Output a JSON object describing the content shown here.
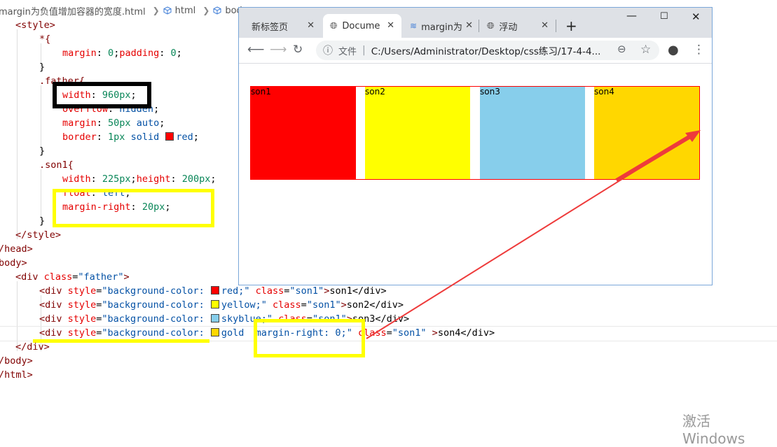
{
  "breadcrumb": {
    "file": "margin为负值增加容器的宽度.html",
    "html": "html",
    "body": "body"
  },
  "code": {
    "l1": "<style>",
    "l2": "*{",
    "l3a": "margin",
    "l3b": ": ",
    "l3c": "0",
    "l3d": ";",
    "l3e": "padding",
    "l3f": ": ",
    "l3g": "0",
    "l3h": ";",
    "l4": "}",
    "l5": ".father{",
    "l6a": "width",
    "l6b": ": ",
    "l6c": "960px",
    "l6d": ";",
    "l7a": "overflow",
    "l7b": ": ",
    "l7c": "hidden",
    "l7d": ";",
    "l8a": "margin",
    "l8b": ": ",
    "l8c": "50px",
    "l8d": " auto",
    "l8e": ";",
    "l9a": "border",
    "l9b": ": ",
    "l9c": "1px",
    "l9d": " solid ",
    "l9e": "red",
    "l9f": ";",
    "l10": "}",
    "l11": ".son1{",
    "l12a": "width",
    "l12b": ": ",
    "l12c": "225px",
    "l12d": ";",
    "l12e": "height",
    "l12f": ": ",
    "l12g": "200px",
    "l12h": ";",
    "l13a": "float",
    "l13b": ": ",
    "l13c": "left",
    "l13d": ";",
    "l14a": "margin-right",
    "l14b": ": ",
    "l14c": "20px",
    "l14d": ";",
    "l15": "}",
    "l16": "</style>",
    "l17": "/head>",
    "l18": "body>",
    "l19a": "<div ",
    "l19b": "class",
    "l19c": "=",
    "l19d": "\"father\"",
    "l19e": ">",
    "divopen": "<div ",
    "style_attr": "style",
    "eq": "=",
    "bgc": "\"background-color: ",
    "cls": "class",
    "son1cls": "\"son1\"",
    "gt": ">",
    "l20a": "red;\"",
    "l20b": "son1</div>",
    "l21a": "yellow;\"",
    "l21b": "son2</div>",
    "l22a": "skyblue;\"",
    "l22b": "son3</div>",
    "l23a": "gold",
    "l23b": "margin-right: 0;",
    "l23c": "\"",
    "l23d": "son4</div>",
    "l24": "</div>",
    "l25": "/body>",
    "l26": "/html>"
  },
  "browser": {
    "tabs": [
      {
        "label": "新标签页"
      },
      {
        "label": "Docume"
      },
      {
        "label": "margin为"
      },
      {
        "label": "浮动"
      }
    ],
    "file_label": "文件",
    "url": "C:/Users/Administrator/Desktop/css练习/17-4-4...",
    "boxes": [
      {
        "label": "son1",
        "color": "#ff0000"
      },
      {
        "label": "son2",
        "color": "#ffff00"
      },
      {
        "label": "son3",
        "color": "#87ceeb"
      },
      {
        "label": "son4",
        "color": "#ffd700"
      }
    ]
  },
  "colors": {
    "highlight": "#ffff00",
    "arrow": "#ee3b3b",
    "border_red": "#ff0000"
  },
  "watermark": "激活 Windows"
}
